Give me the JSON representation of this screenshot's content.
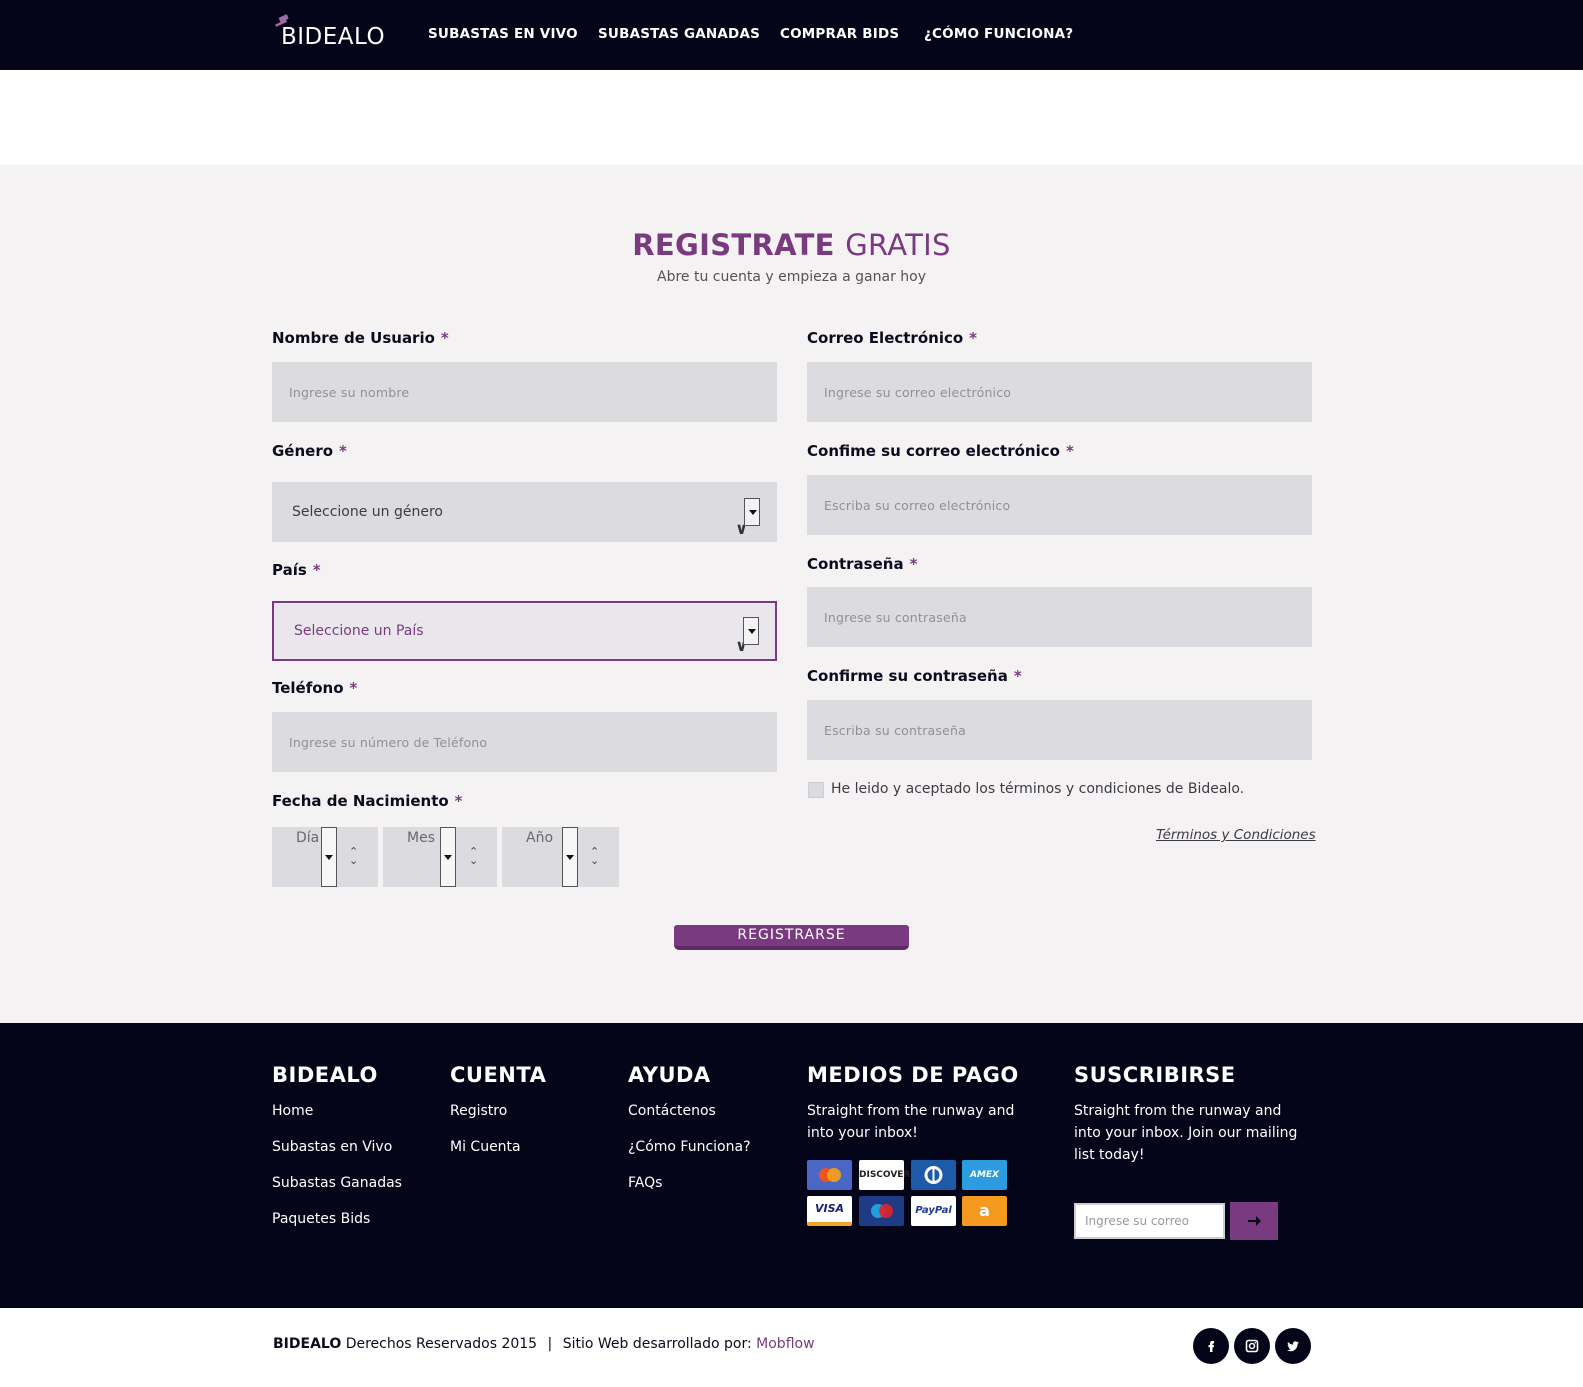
{
  "header": {
    "logo_text": "BIDEALO",
    "nav": [
      "SUBASTAS EN VIVO",
      "SUBASTAS GANADAS",
      "COMPRAR BIDS",
      "¿CÓMO FUNCIONA?"
    ]
  },
  "form": {
    "title_bold": "REGISTRATE",
    "title_light": "GRATIS",
    "subtitle": "Abre tu cuenta y empieza a ganar hoy",
    "required_mark": "*",
    "username": {
      "label": "Nombre de Usuario",
      "placeholder": "Ingrese su nombre"
    },
    "email": {
      "label": "Correo Electrónico",
      "placeholder": "Ingrese su correo electrónico"
    },
    "gender": {
      "label": "Género",
      "value": "Seleccione un género"
    },
    "confirm_email": {
      "label": "Confime su correo electrónico",
      "placeholder": "Escriba su correo electrónico"
    },
    "country": {
      "label": "País",
      "value": "Seleccione un País"
    },
    "password": {
      "label": "Contraseña",
      "placeholder": "Ingrese su contraseña"
    },
    "phone": {
      "label": "Teléfono",
      "placeholder": "Ingrese su número de Teléfono"
    },
    "confirm_password": {
      "label": "Confirme su contraseña",
      "placeholder": "Escriba su contraseña"
    },
    "birthdate": {
      "label": "Fecha de Nacimiento",
      "day": "Día",
      "month": "Mes",
      "year": "Año"
    },
    "terms_check": "He leido y aceptado los términos y condiciones de Bidealo.",
    "terms_link": "Términos y Condiciones",
    "submit": "REGISTRARSE"
  },
  "footer": {
    "col1": {
      "title": "BIDEALO",
      "links": [
        "Home",
        "Subastas en Vivo",
        "Subastas Ganadas",
        "Paquetes Bids"
      ]
    },
    "col2": {
      "title": "CUENTA",
      "links": [
        "Registro",
        "Mi Cuenta"
      ]
    },
    "col3": {
      "title": "AYUDA",
      "links": [
        "Contáctenos",
        "¿Cómo Funciona?",
        "FAQs"
      ]
    },
    "col4": {
      "title": "MEDIOS DE PAGO",
      "text": "Straight from the runway and into your inbox!",
      "cards": [
        "mastercard",
        "DISCOVER",
        "diners",
        "AMEX",
        "VISA",
        "maestro",
        "PayPal",
        "amazon"
      ]
    },
    "col5": {
      "title": "SUSCRIBIRSE",
      "text": "Straight from the runway and into your inbox. Join our mailing list today!",
      "placeholder": "Ingrese su correo"
    }
  },
  "bottom": {
    "brand": "BIDEALO",
    "rights": "Derechos Reservados 2015",
    "divider": "|",
    "dev_label": "Sitio Web desarrollado por:",
    "dev_name": "Mobflow",
    "social": [
      "facebook-icon",
      "instagram-icon",
      "twitter-icon"
    ]
  },
  "colors": {
    "accent": "#7a3a80",
    "dark": "#05051a",
    "form_bg": "#f4f2f3",
    "input_bg": "#dcdbe0"
  }
}
